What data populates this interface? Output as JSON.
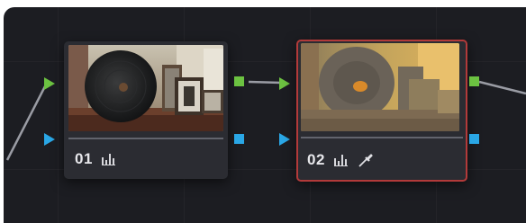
{
  "nodes": [
    {
      "number": "01",
      "selected": false,
      "icons": [
        "levels-icon"
      ]
    },
    {
      "number": "02",
      "selected": true,
      "icons": [
        "levels-icon",
        "eyedropper-icon"
      ]
    }
  ],
  "colors": {
    "background": "#1c1d22",
    "node": "#2b2c32",
    "rgb_port": "#6cc241",
    "alpha_port": "#2aa7e6",
    "selection": "#b23a3a",
    "wire": "#9a9ca4"
  }
}
